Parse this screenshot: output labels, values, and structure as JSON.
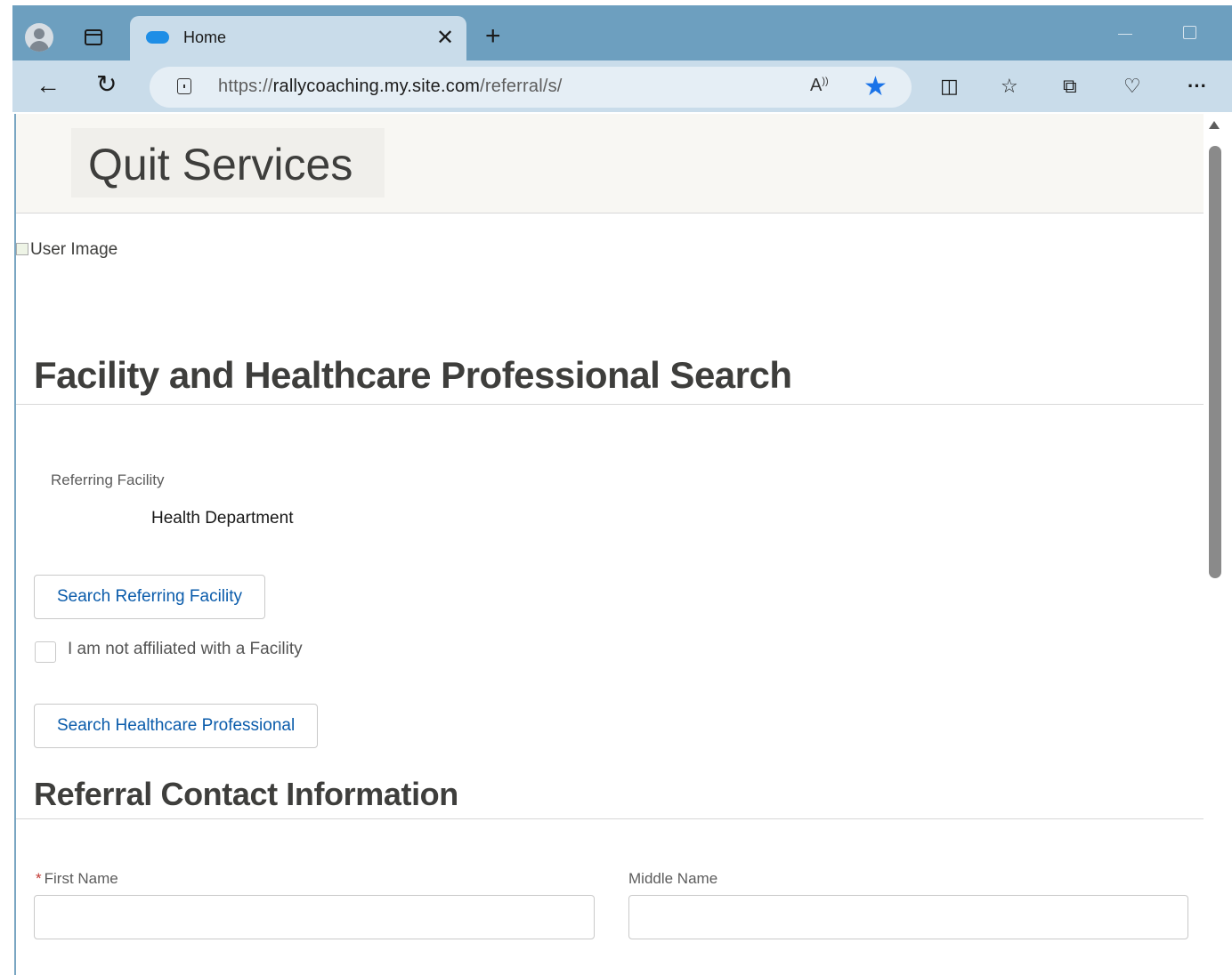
{
  "browser": {
    "tab_title": "Home",
    "url_prefix": "https://",
    "url_domain": "rallycoaching.my.site.com",
    "url_path": "/referral/s/",
    "icons": [
      "profile-icon",
      "tabs-icon",
      "salesforce-cloud-icon",
      "close-icon",
      "new-tab-icon",
      "back-icon",
      "reload-icon",
      "lock-icon",
      "read-aloud-icon",
      "favorite-star-icon",
      "split-screen-icon",
      "favorites-icon",
      "collections-icon",
      "browser-essentials-icon",
      "more-icon"
    ],
    "accent_color": "#1a73e8"
  },
  "header": {
    "brand": "Quit Services"
  },
  "user_image_alt": "User Image",
  "facility_section": {
    "title": "Facility and Healthcare Professional Search",
    "referring_facility_label": "Referring Facility",
    "referring_facility_value": "Health Department",
    "search_facility_button": "Search Referring Facility",
    "not_affiliated_label": "I am not affiliated with a Facility",
    "search_professional_button": "Search Healthcare Professional"
  },
  "contact_section": {
    "title": "Referral Contact Information",
    "first_name_label": "First Name",
    "required_marker": "*",
    "middle_name_label": "Middle Name"
  }
}
